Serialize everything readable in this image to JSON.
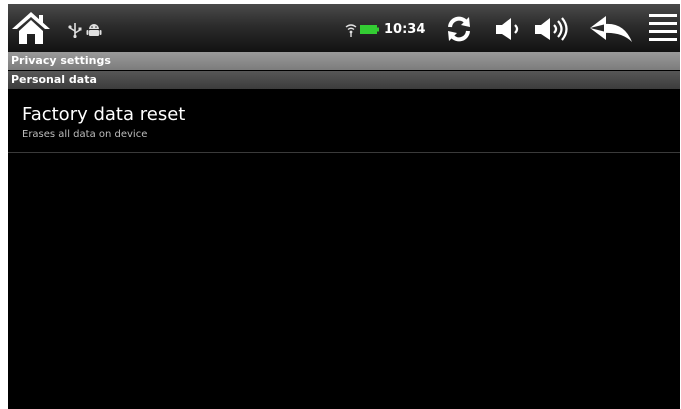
{
  "status_bar": {
    "time": "10:34",
    "icons": [
      "home-icon",
      "usb-icon",
      "android-debug-icon",
      "wifi-signal-icon",
      "battery-icon",
      "sync-icon",
      "volume-down-icon",
      "volume-up-icon",
      "back-icon",
      "menu-icon"
    ],
    "battery_color": "#33cc33"
  },
  "screen": {
    "title": "Privacy settings",
    "category": "Personal data",
    "items": [
      {
        "title": "Factory data reset",
        "summary": "Erases all data on device"
      }
    ]
  },
  "colors": {
    "background": "#000000",
    "title_bar": "#8a8a8a",
    "category_header": "#4a4a4a"
  }
}
